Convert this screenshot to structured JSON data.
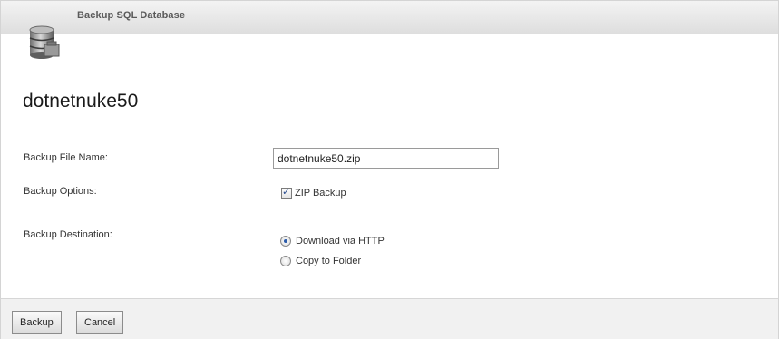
{
  "window": {
    "title": "Backup SQL Database",
    "icon": "database-icon"
  },
  "database": {
    "name": "dotnetnuke50"
  },
  "form": {
    "file_name_label": "Backup File Name:",
    "file_name_value": "dotnetnuke50.zip",
    "options_label": "Backup Options:",
    "zip_backup_label": "ZIP Backup",
    "zip_backup_checked": true,
    "destination_label": "Backup Destination:",
    "destinations": [
      {
        "label": "Download via HTTP",
        "selected": true
      },
      {
        "label": "Copy to Folder",
        "selected": false
      }
    ]
  },
  "footer": {
    "backup_label": "Backup",
    "cancel_label": "Cancel"
  }
}
